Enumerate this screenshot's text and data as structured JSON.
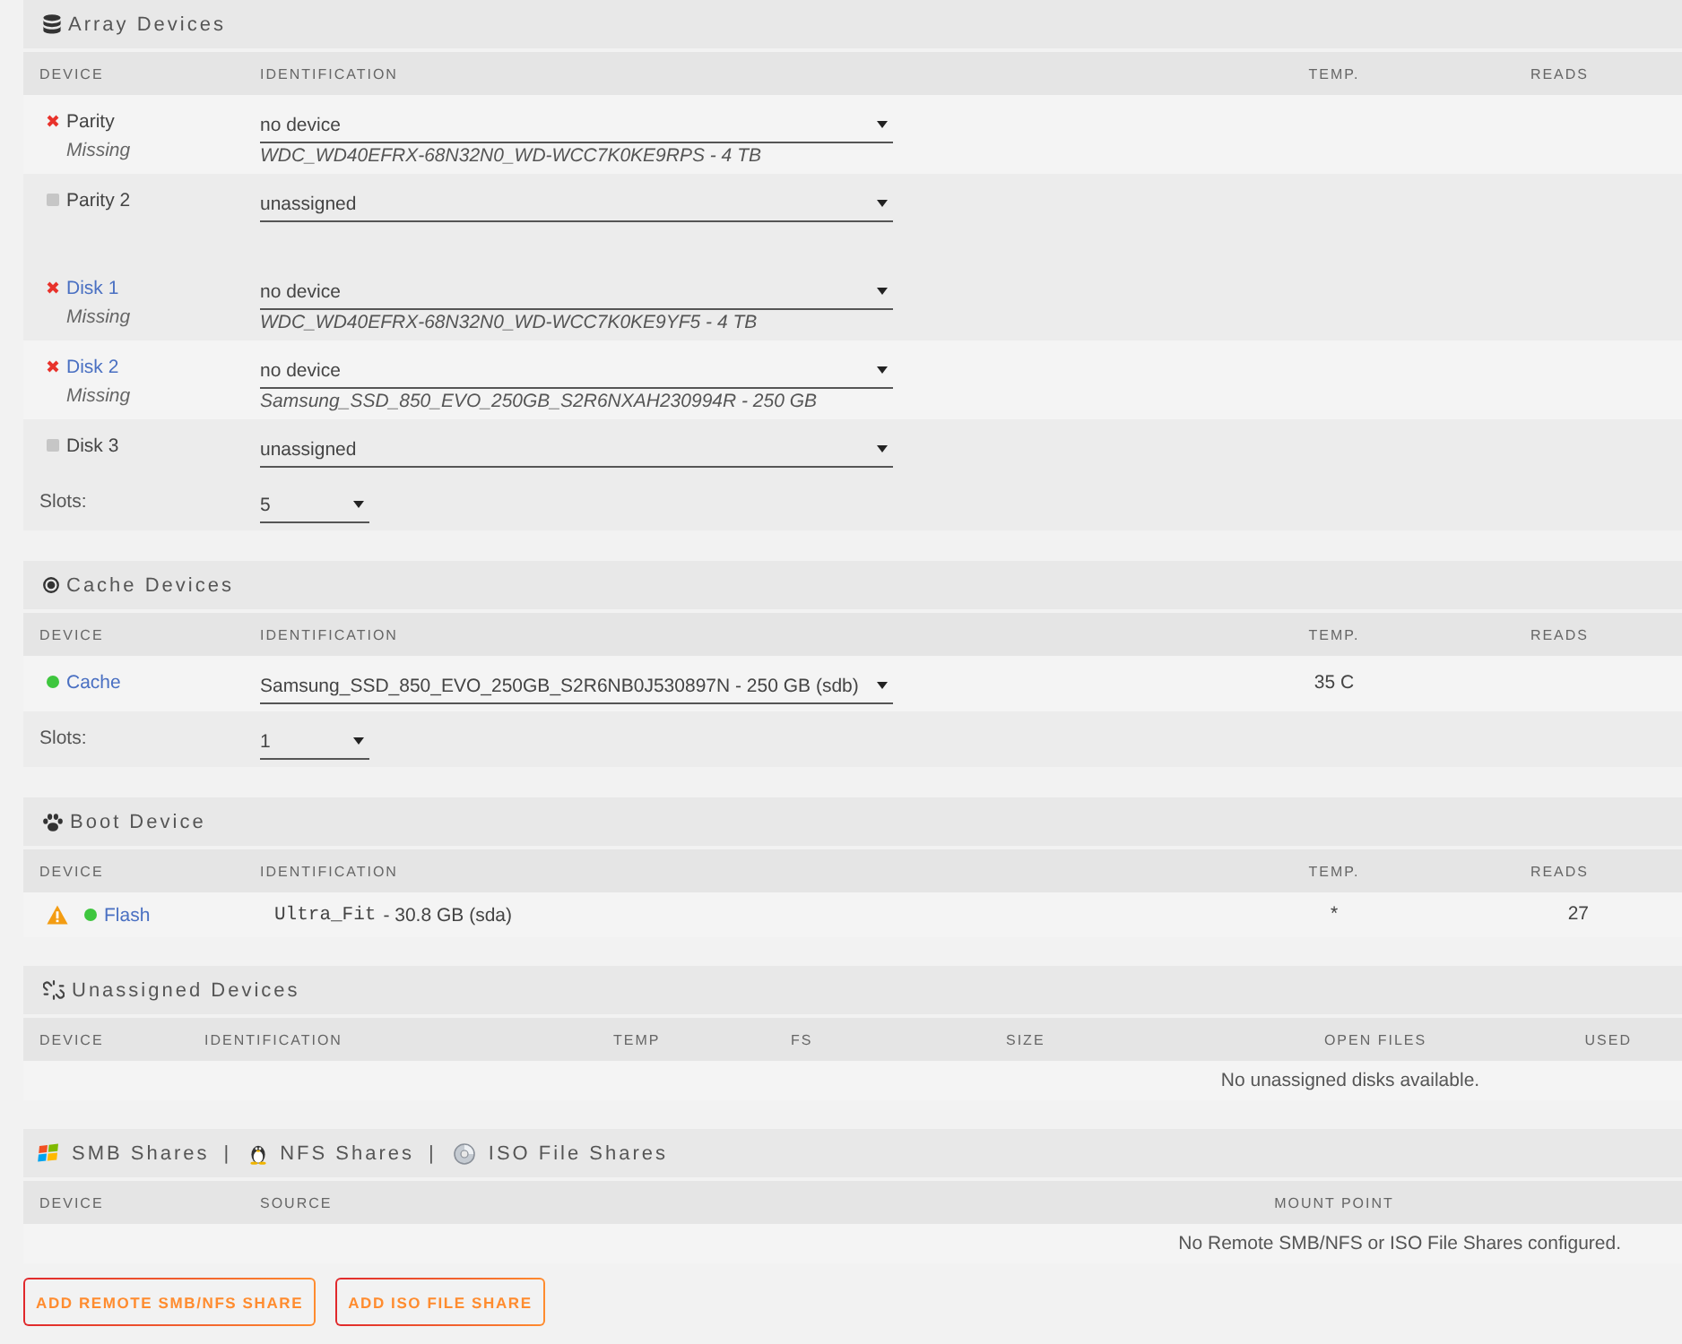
{
  "array_devices": {
    "title": "Array Devices",
    "columns": [
      "DEVICE",
      "IDENTIFICATION",
      "TEMP.",
      "READS"
    ],
    "parity": [
      {
        "name": "Parity",
        "kind": "missing",
        "link": false,
        "note": "Missing",
        "selection": "no device",
        "assigned": "WDC_WD40EFRX-68N32N0_WD-WCC7K0KE9RPS - 4 TB"
      },
      {
        "name": "Parity 2",
        "kind": "unassigned",
        "link": false,
        "selection": "unassigned"
      }
    ],
    "disks": [
      {
        "name": "Disk 1",
        "kind": "missing",
        "link": true,
        "note": "Missing",
        "selection": "no device",
        "assigned": "WDC_WD40EFRX-68N32N0_WD-WCC7K0KE9YF5 - 4 TB"
      },
      {
        "name": "Disk 2",
        "kind": "missing",
        "link": true,
        "note": "Missing",
        "selection": "no device",
        "assigned": "Samsung_SSD_850_EVO_250GB_S2R6NXAH230994R - 250 GB"
      },
      {
        "name": "Disk 3",
        "kind": "unassigned",
        "link": false,
        "selection": "unassigned"
      }
    ],
    "slots": {
      "label": "Slots:",
      "value": "5"
    }
  },
  "cache_devices": {
    "title": "Cache Devices",
    "columns": [
      "DEVICE",
      "IDENTIFICATION",
      "TEMP.",
      "READS"
    ],
    "devices": [
      {
        "name": "Cache",
        "kind": "online",
        "link": true,
        "selection": "Samsung_SSD_850_EVO_250GB_S2R6NB0J530897N - 250 GB (sdb)",
        "temp": "35 C"
      }
    ],
    "slots": {
      "label": "Slots:",
      "value": "1"
    }
  },
  "boot_device": {
    "title": "Boot Device",
    "columns": [
      "DEVICE",
      "IDENTIFICATION",
      "TEMP.",
      "READS"
    ],
    "devices": [
      {
        "name": "Flash",
        "kind": "online",
        "warning": true,
        "link": true,
        "model": "Ultra_Fit",
        "size": "- 30.8 GB (sda)",
        "temp": "*",
        "reads": "27"
      }
    ]
  },
  "unassigned_devices": {
    "title": "Unassigned Devices",
    "columns": [
      "DEVICE",
      "IDENTIFICATION",
      "TEMP",
      "FS",
      "SIZE",
      "OPEN FILES",
      "USED"
    ],
    "message": "No unassigned disks available."
  },
  "shares": {
    "title_items": [
      {
        "kind": "smb",
        "label": "SMB Shares"
      },
      {
        "kind": "separator",
        "label": "|"
      },
      {
        "kind": "nfs",
        "label": "NFS Shares"
      },
      {
        "kind": "separator",
        "label": "|"
      },
      {
        "kind": "iso",
        "label": "ISO File Shares"
      }
    ],
    "columns": [
      "DEVICE",
      "SOURCE",
      "MOUNT POINT"
    ],
    "message": "No Remote SMB/NFS or ISO File Shares configured.",
    "buttons": [
      "ADD REMOTE SMB/NFS SHARE",
      "ADD ISO FILE SHARE"
    ]
  }
}
